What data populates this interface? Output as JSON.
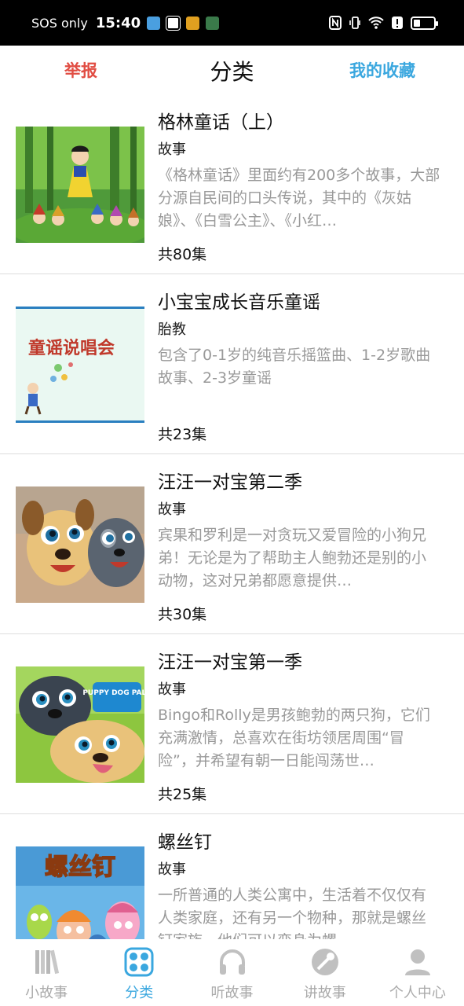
{
  "status_bar": {
    "carrier": "SOS only",
    "time": "15:40"
  },
  "header": {
    "report_label": "举报",
    "title": "分类",
    "favorites_label": "我的收藏"
  },
  "items": [
    {
      "title": "格林童话（上）",
      "category": "故事",
      "description": "《格林童话》里面约有200多个故事，大部分源自民间的口头传说，其中的《灰姑娘》、《白雪公主》、《小红…",
      "count": "共80集",
      "thumbnail": "snow-white-dwarfs-forest"
    },
    {
      "title": "小宝宝成长音乐童谣",
      "category": "胎教",
      "description": "包含了0-1岁的纯音乐摇篮曲、1-2岁歌曲故事、2-3岁童谣",
      "count": "共23集",
      "thumbnail": "童谣说唱会"
    },
    {
      "title": "汪汪一对宝第二季",
      "category": "故事",
      "description": "宾果和罗利是一对贪玩又爱冒险的小狗兄弟！无论是为了帮助主人鲍勃还是别的小动物，这对兄弟都愿意提供…",
      "count": "共30集",
      "thumbnail": "puppy-dog-pals-s2"
    },
    {
      "title": "汪汪一对宝第一季",
      "category": "故事",
      "description": "Bingo和Rolly是男孩鲍勃的两只狗，它们充满激情，总喜欢在街坊领居周围“冒险”，并希望有朝一日能闯荡世…",
      "count": "共25集",
      "thumbnail": "PUPPY DOG PALS"
    },
    {
      "title": "螺丝钉",
      "category": "故事",
      "description": "一所普通的人类公寓中，生活着不仅仅有人类家庭，还有另一个物种，那就是螺丝钉家族，他们可以变身为螺…",
      "count": "",
      "thumbnail": "螺丝钉"
    }
  ],
  "tabs": [
    {
      "label": "小故事",
      "icon": "books-icon",
      "active": false
    },
    {
      "label": "分类",
      "icon": "category-icon",
      "active": true
    },
    {
      "label": "听故事",
      "icon": "headphones-icon",
      "active": false
    },
    {
      "label": "讲故事",
      "icon": "microphone-icon",
      "active": false
    },
    {
      "label": "个人中心",
      "icon": "person-icon",
      "active": false
    }
  ],
  "colors": {
    "accent": "#3aa7df",
    "report": "#e14d43",
    "inactive_tab": "#aaaaaa",
    "description": "#999999"
  }
}
